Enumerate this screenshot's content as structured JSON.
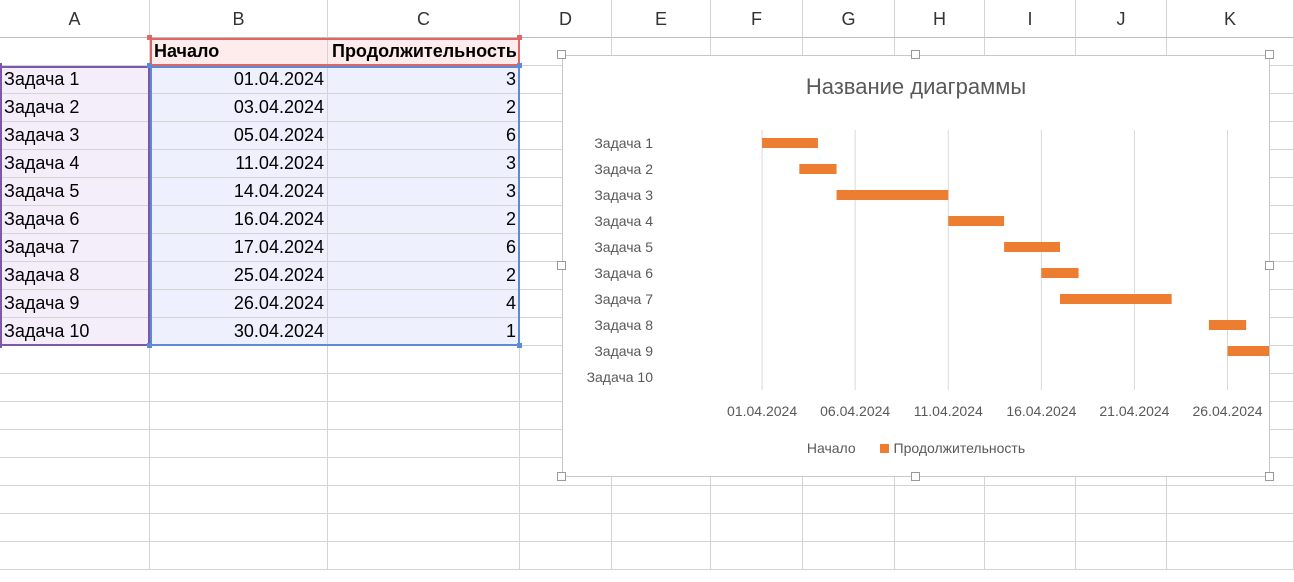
{
  "columns": [
    "A",
    "B",
    "C",
    "D",
    "E",
    "F",
    "G",
    "H",
    "I",
    "J",
    "K"
  ],
  "table": {
    "header": [
      "",
      "Начало",
      "Продолжительность"
    ],
    "rows": [
      [
        "Задача 1",
        "01.04.2024",
        "3"
      ],
      [
        "Задача 2",
        "03.04.2024",
        "2"
      ],
      [
        "Задача 3",
        "05.04.2024",
        "6"
      ],
      [
        "Задача 4",
        "11.04.2024",
        "3"
      ],
      [
        "Задача 5",
        "14.04.2024",
        "3"
      ],
      [
        "Задача 6",
        "16.04.2024",
        "2"
      ],
      [
        "Задача 7",
        "17.04.2024",
        "6"
      ],
      [
        "Задача 8",
        "25.04.2024",
        "2"
      ],
      [
        "Задача 9",
        "26.04.2024",
        "4"
      ],
      [
        "Задача 10",
        "30.04.2024",
        "1"
      ]
    ]
  },
  "colors": {
    "series_duration": "#ed7d31",
    "gridline": "#d9d9d9",
    "ref_red": "#e06666",
    "ref_purple": "#7e57a8",
    "ref_blue": "#5b8bd6"
  },
  "chart_data": {
    "type": "bar",
    "orientation": "horizontal-stacked",
    "title": "Название диаграммы",
    "categories": [
      "Задача 1",
      "Задача 2",
      "Задача 3",
      "Задача 4",
      "Задача 5",
      "Задача 6",
      "Задача 7",
      "Задача 8",
      "Задача 9",
      "Задача 10"
    ],
    "series": [
      {
        "name": "Начало",
        "values": [
          "2024-04-01",
          "2024-04-03",
          "2024-04-05",
          "2024-04-11",
          "2024-04-14",
          "2024-04-16",
          "2024-04-17",
          "2024-04-25",
          "2024-04-26",
          "2024-04-30"
        ],
        "visible": false
      },
      {
        "name": "Продолжительность",
        "values": [
          3,
          2,
          6,
          3,
          3,
          2,
          6,
          2,
          4,
          1
        ],
        "color": "#ed7d31"
      }
    ],
    "x_ticks": [
      "01.04.2024",
      "06.04.2024",
      "11.04.2024",
      "16.04.2024",
      "21.04.2024",
      "26.04.2024"
    ],
    "xlim": [
      "2024-03-27",
      "2024-04-30"
    ],
    "grid": true,
    "legend": "bottom"
  }
}
